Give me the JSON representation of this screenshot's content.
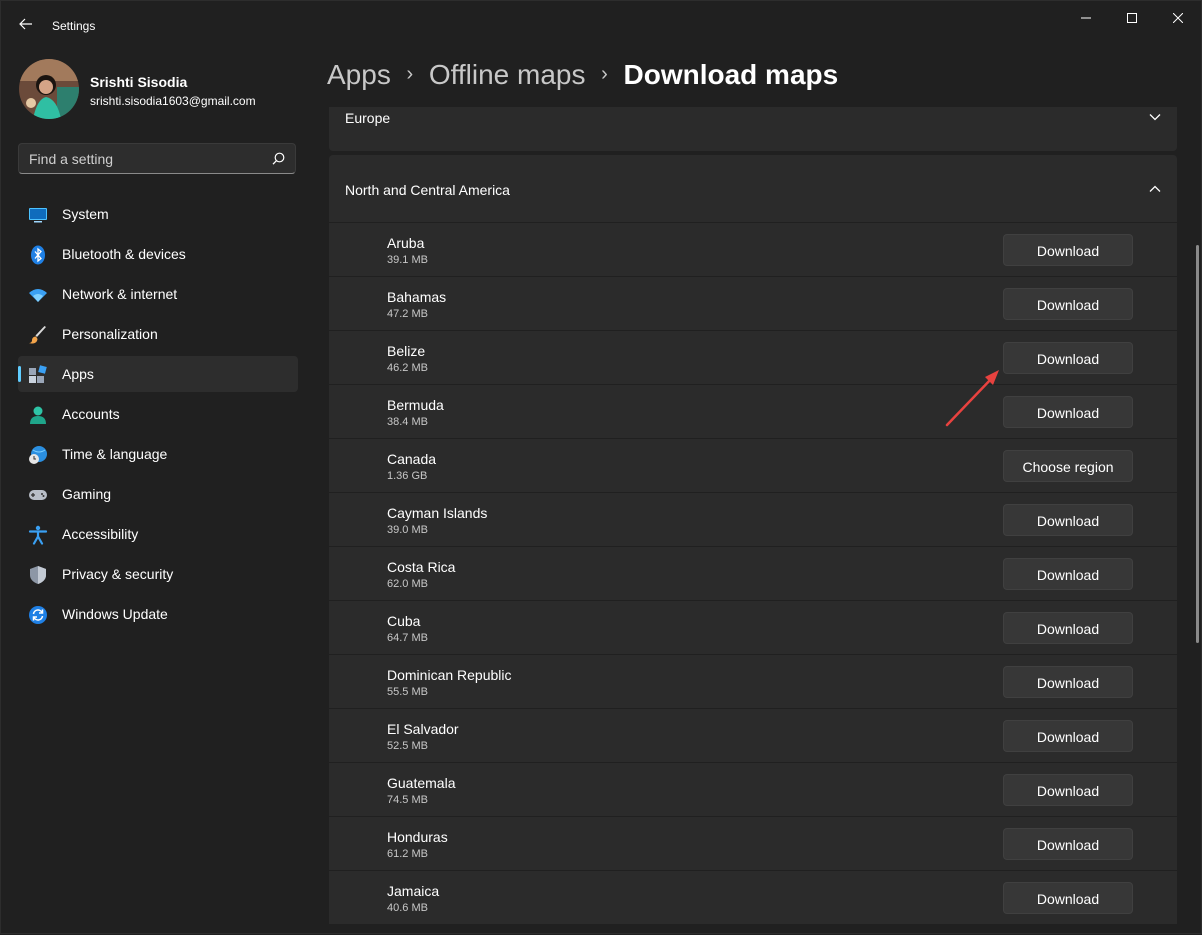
{
  "window": {
    "title": "Settings"
  },
  "user": {
    "name": "Srishti Sisodia",
    "email": "srishti.sisodia1603@gmail.com"
  },
  "search": {
    "placeholder": "Find a setting"
  },
  "nav": [
    {
      "label": "System",
      "icon": "system-icon"
    },
    {
      "label": "Bluetooth & devices",
      "icon": "bluetooth-icon"
    },
    {
      "label": "Network & internet",
      "icon": "wifi-icon"
    },
    {
      "label": "Personalization",
      "icon": "brush-icon"
    },
    {
      "label": "Apps",
      "icon": "apps-icon",
      "active": true
    },
    {
      "label": "Accounts",
      "icon": "accounts-icon"
    },
    {
      "label": "Time & language",
      "icon": "globe-clock-icon"
    },
    {
      "label": "Gaming",
      "icon": "controller-icon"
    },
    {
      "label": "Accessibility",
      "icon": "accessibility-icon"
    },
    {
      "label": "Privacy & security",
      "icon": "shield-icon"
    },
    {
      "label": "Windows Update",
      "icon": "update-icon"
    }
  ],
  "breadcrumb": {
    "part1": "Apps",
    "part2": "Offline maps",
    "current": "Download maps"
  },
  "sections": {
    "europe": "Europe",
    "nca": "North and Central America"
  },
  "maps": [
    {
      "name": "Aruba",
      "size": "39.1 MB",
      "action": "Download"
    },
    {
      "name": "Bahamas",
      "size": "47.2 MB",
      "action": "Download"
    },
    {
      "name": "Belize",
      "size": "46.2 MB",
      "action": "Download"
    },
    {
      "name": "Bermuda",
      "size": "38.4 MB",
      "action": "Download"
    },
    {
      "name": "Canada",
      "size": "1.36 GB",
      "action": "Choose region"
    },
    {
      "name": "Cayman Islands",
      "size": "39.0 MB",
      "action": "Download"
    },
    {
      "name": "Costa Rica",
      "size": "62.0 MB",
      "action": "Download"
    },
    {
      "name": "Cuba",
      "size": "64.7 MB",
      "action": "Download"
    },
    {
      "name": "Dominican Republic",
      "size": "55.5 MB",
      "action": "Download"
    },
    {
      "name": "El Salvador",
      "size": "52.5 MB",
      "action": "Download"
    },
    {
      "name": "Guatemala",
      "size": "74.5 MB",
      "action": "Download"
    },
    {
      "name": "Honduras",
      "size": "61.2 MB",
      "action": "Download"
    },
    {
      "name": "Jamaica",
      "size": "40.6 MB",
      "action": "Download"
    }
  ],
  "colors": {
    "accent": "#60cdff",
    "annotation": "#e8423f"
  }
}
